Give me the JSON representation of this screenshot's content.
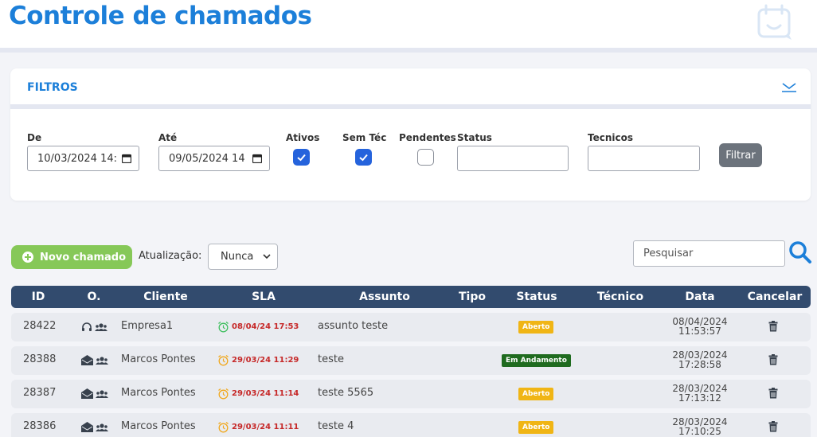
{
  "header": {
    "title": "Controle de chamados",
    "icon": "calendar-smile-icon"
  },
  "filters": {
    "title": "FILTROS",
    "de": {
      "label": "De",
      "value": "10/03/2024 14:"
    },
    "ate": {
      "label": "Até",
      "value": "09/05/2024 14"
    },
    "ativos": {
      "label": "Ativos",
      "checked": true
    },
    "sem_tec": {
      "label": "Sem Téc",
      "checked": true
    },
    "pendentes": {
      "label": "Pendentes",
      "checked": false
    },
    "status": {
      "label": "Status",
      "value": ""
    },
    "tecnicos": {
      "label": "Tecnicos",
      "value": ""
    },
    "filtrar_label": "Filtrar"
  },
  "toolbar": {
    "new_label": "Novo chamado",
    "refresh_label": "Atualização:",
    "refresh_value": "Nunca",
    "search_placeholder": "Pesquisar"
  },
  "table": {
    "headers": [
      "ID",
      "O.",
      "Cliente",
      "SLA",
      "Assunto",
      "Tipo",
      "Status",
      "Técnico",
      "Data",
      "Cancelar"
    ],
    "rows": [
      {
        "id": "28422",
        "origin_icon": "headset-icon",
        "cliente": "Empresa1",
        "sla": "08/04/24 17:53",
        "sla_color": "green",
        "assunto": "assunto teste",
        "tipo": "",
        "status": "Aberto",
        "status_kind": "aberto",
        "tecnico": "",
        "data_date": "08/04/2024",
        "data_time": "11:53:57"
      },
      {
        "id": "28388",
        "origin_icon": "email-icon",
        "cliente": "Marcos Pontes",
        "sla": "29/03/24 11:29",
        "sla_color": "orange",
        "assunto": "teste",
        "tipo": "",
        "status": "Em Andamento",
        "status_kind": "andamento",
        "tecnico": "",
        "data_date": "28/03/2024",
        "data_time": "17:28:58"
      },
      {
        "id": "28387",
        "origin_icon": "email-icon",
        "cliente": "Marcos Pontes",
        "sla": "29/03/24 11:14",
        "sla_color": "orange",
        "assunto": "teste 5565",
        "tipo": "",
        "status": "Aberto",
        "status_kind": "aberto",
        "tecnico": "",
        "data_date": "28/03/2024",
        "data_time": "17:13:12"
      },
      {
        "id": "28386",
        "origin_icon": "email-icon",
        "cliente": "Marcos Pontes",
        "sla": "29/03/24 11:11",
        "sla_color": "orange",
        "assunto": "teste 4",
        "tipo": "",
        "status": "Aberto",
        "status_kind": "aberto",
        "tecnico": "",
        "data_date": "28/03/2024",
        "data_time": "17:10:25"
      }
    ]
  },
  "colors": {
    "primary": "#1c7fd9",
    "header_bar": "#324b6e",
    "success": "#86c858",
    "aberto": "#f0b515",
    "andamento": "#1f6b1f",
    "sla_red": "#c62828"
  }
}
